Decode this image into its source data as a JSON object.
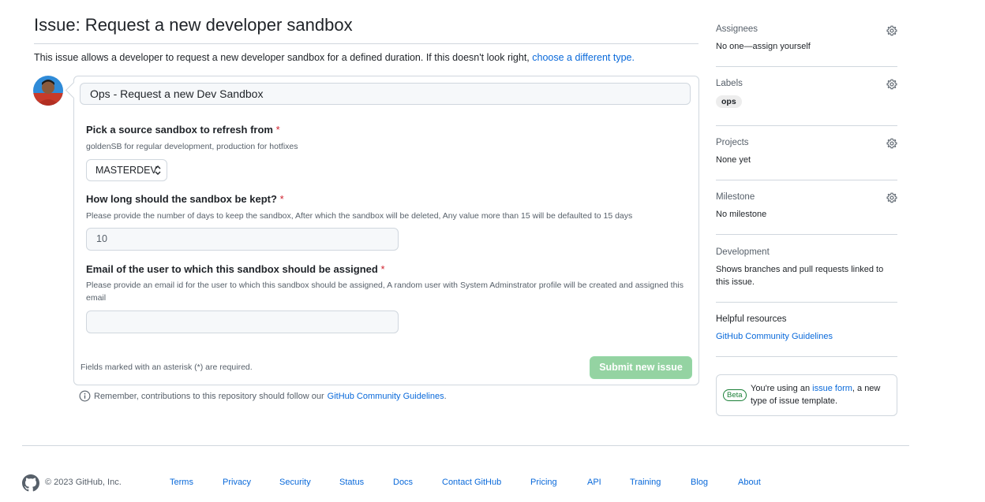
{
  "issue": {
    "title": "Issue: Request a new developer sandbox",
    "description_prefix": "This issue allows a developer to request a new developer sandbox for a defined duration. If this doesn't look right,",
    "description_link": "choose a different type."
  },
  "form": {
    "title_value": "Ops - Request a new Dev Sandbox",
    "field1": {
      "label": "Pick a source sandbox to refresh from",
      "required_mark": "*",
      "help": "goldenSB for regular development, production for hotfixes",
      "selected": "MASTERDEV"
    },
    "field2": {
      "label": "How long should the sandbox be kept?",
      "required_mark": "*",
      "help": "Please provide the number of days to keep the sandbox, After which the sandbox will be deleted, Any value more than 15 will be defaulted to 15 days",
      "value": "10"
    },
    "field3": {
      "label": "Email of the user to which this sandbox should be assigned",
      "required_mark": "*",
      "help": "Please provide an email id for the user to which this sandbox should be assigned, A random user with System Adminstrator profile will be created and assigned this email",
      "value": ""
    },
    "footnote": "Fields marked with an asterisk (*) are required.",
    "submit_label": "Submit new issue"
  },
  "remember": {
    "prefix": "Remember, contributions to this repository should follow our",
    "link": "GitHub Community Guidelines",
    "suffix": "."
  },
  "sidebar": {
    "assignees": {
      "heading": "Assignees",
      "value": "No one—assign yourself"
    },
    "labels": {
      "heading": "Labels",
      "pill": "ops"
    },
    "projects": {
      "heading": "Projects",
      "value": "None yet"
    },
    "milestone": {
      "heading": "Milestone",
      "value": "No milestone"
    },
    "development": {
      "heading": "Development",
      "value": "Shows branches and pull requests linked to this issue."
    },
    "helpful": {
      "heading": "Helpful resources",
      "link": "GitHub Community Guidelines"
    },
    "beta": {
      "badge": "Beta",
      "prefix": "You're using an",
      "link": "issue form",
      "suffix": ", a new type of issue template."
    }
  },
  "footer": {
    "copyright": "© 2023 GitHub, Inc.",
    "links": [
      "Terms",
      "Privacy",
      "Security",
      "Status",
      "Docs",
      "Contact GitHub",
      "Pricing",
      "API",
      "Training",
      "Blog",
      "About"
    ]
  },
  "colors": {
    "link": "#0969da",
    "required": "#cf222e",
    "submit_disabled": "#94d3a2",
    "beta_green": "#1a7f37"
  }
}
